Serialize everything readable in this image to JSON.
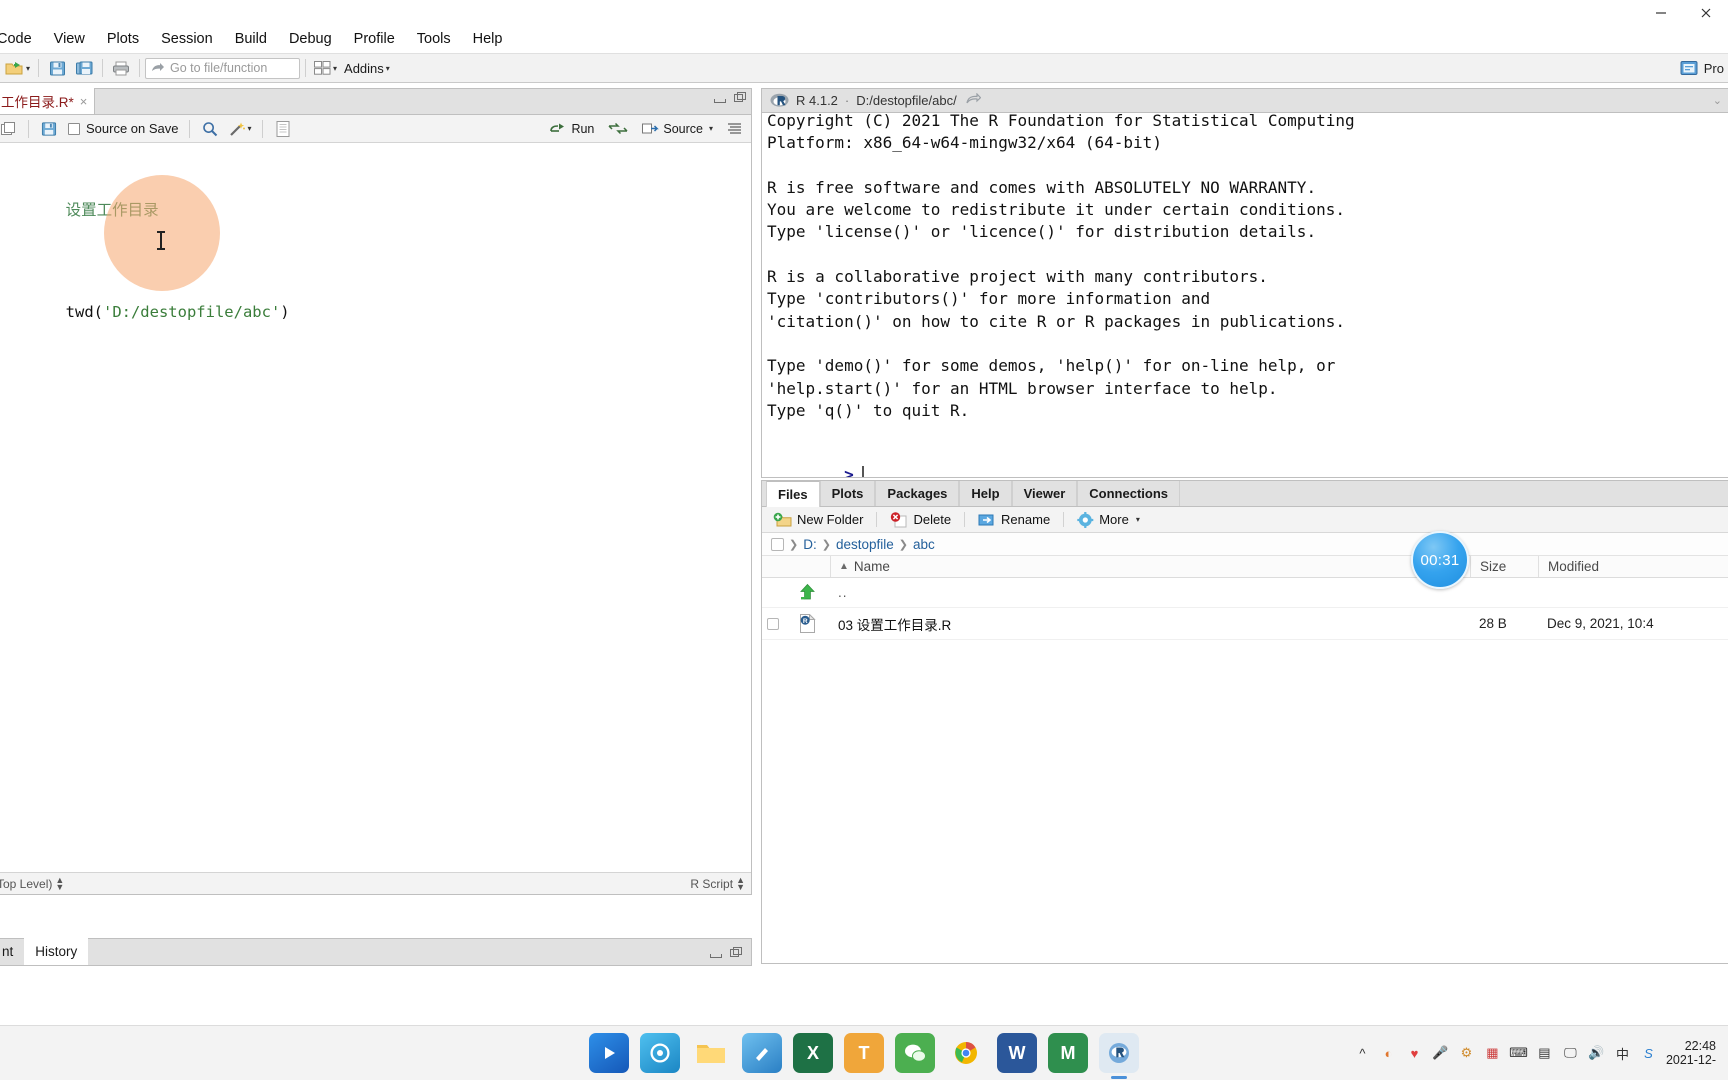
{
  "window": {
    "controls": [
      {
        "name": "minimize",
        "glyph": "—"
      },
      {
        "name": "close",
        "glyph": "✕"
      }
    ]
  },
  "menubar": {
    "items": [
      "Code",
      "View",
      "Plots",
      "Session",
      "Build",
      "Debug",
      "Profile",
      "Tools",
      "Help"
    ]
  },
  "toolbar": {
    "goto_placeholder": "Go to file/function",
    "addins_label": "Addins",
    "pro_label": "Pro"
  },
  "source": {
    "tab_label": "工作目录.R*",
    "tab_close": "×",
    "source_on_save_label": "Source on Save",
    "run_label": "Run",
    "source_label": "Source",
    "code_lines": [
      {
        "type": "comment",
        "text": "设置工作目录"
      },
      {
        "type": "code",
        "fn": "twd(",
        "str": "'D:/destopfile/abc'",
        "close": ")"
      }
    ],
    "status_left": "Top Level)",
    "status_right": "R Script"
  },
  "console": {
    "version": "R 4.1.2",
    "separator": "·",
    "path": "D:/destopfile/abc/",
    "lines": [
      "Copyright (C) 2021 The R Foundation for Statistical Computing",
      "Platform: x86_64-w64-mingw32/x64 (64-bit)",
      "",
      "R is free software and comes with ABSOLUTELY NO WARRANTY.",
      "You are welcome to redistribute it under certain conditions.",
      "Type 'license()' or 'licence()' for distribution details.",
      "",
      "R is a collaborative project with many contributors.",
      "Type 'contributors()' for more information and",
      "'citation()' on how to cite R or R packages in publications.",
      "",
      "Type 'demo()' for some demos, 'help()' for on-line help, or",
      "'help.start()' for an HTML browser interface to help.",
      "Type 'q()' to quit R."
    ],
    "prompt": ">"
  },
  "files_pane": {
    "tabs": [
      {
        "label": "Files",
        "active": true
      },
      {
        "label": "Plots",
        "active": false
      },
      {
        "label": "Packages",
        "active": false
      },
      {
        "label": "Help",
        "active": false
      },
      {
        "label": "Viewer",
        "active": false
      },
      {
        "label": "Connections",
        "active": false
      }
    ],
    "toolbar": {
      "new_folder": "New Folder",
      "delete": "Delete",
      "rename": "Rename",
      "more": "More"
    },
    "breadcrumb": [
      "D:",
      "destopfile",
      "abc"
    ],
    "columns": {
      "name": "Name",
      "size": "Size",
      "modified": "Modified"
    },
    "rows": [
      {
        "icon": "up-arrow",
        "name": "..",
        "size": "",
        "modified": ""
      },
      {
        "icon": "r-file",
        "name": "03 设置工作目录.R",
        "size": "28 B",
        "modified": "Dec 9, 2021, 10:4"
      }
    ]
  },
  "bottom_left": {
    "tabs": [
      {
        "label": "nt",
        "active": false
      },
      {
        "label": "History",
        "active": true
      }
    ]
  },
  "overlays": {
    "timer": "00:31"
  },
  "taskbar": {
    "apps": [
      {
        "name": "video-player",
        "glyph": "▶",
        "color": "#1d6fe0"
      },
      {
        "name": "browser-360",
        "glyph": "◎",
        "color": "#2e9bd6"
      },
      {
        "name": "file-explorer",
        "glyph": "🗂",
        "color": "#f0b93b"
      },
      {
        "name": "paint",
        "glyph": "✎",
        "color": "#4a9fe0"
      },
      {
        "name": "excel",
        "glyph": "X",
        "color": "#1e7145"
      },
      {
        "name": "text-editor",
        "glyph": "T",
        "color": "#e8a33d"
      },
      {
        "name": "wechat",
        "glyph": "●",
        "color": "#4caf50"
      },
      {
        "name": "chrome",
        "glyph": "◉",
        "color": "#dd5144"
      },
      {
        "name": "word",
        "glyph": "W",
        "color": "#2b579a"
      },
      {
        "name": "xmind",
        "glyph": "M",
        "color": "#2f8f4e"
      },
      {
        "name": "rstudio",
        "glyph": "R",
        "color": "#75aadb"
      }
    ],
    "tray": [
      "^",
      "◐",
      "♥",
      "🎤",
      "⚙",
      "📶",
      "⌨",
      "▦",
      "🖵",
      "🔊",
      "中",
      "S"
    ],
    "clock_time": "22:48",
    "clock_date": "2021-12-"
  },
  "colors": {
    "accent": "#4a90d9",
    "tab_red": "#8b1a1a",
    "comment_green": "#4e8a5a",
    "string_green": "#3a7d3a",
    "prompt_blue": "#1b1b8f",
    "halo_orange": "#f6a66e",
    "timer_blue": "#35a3ee"
  }
}
